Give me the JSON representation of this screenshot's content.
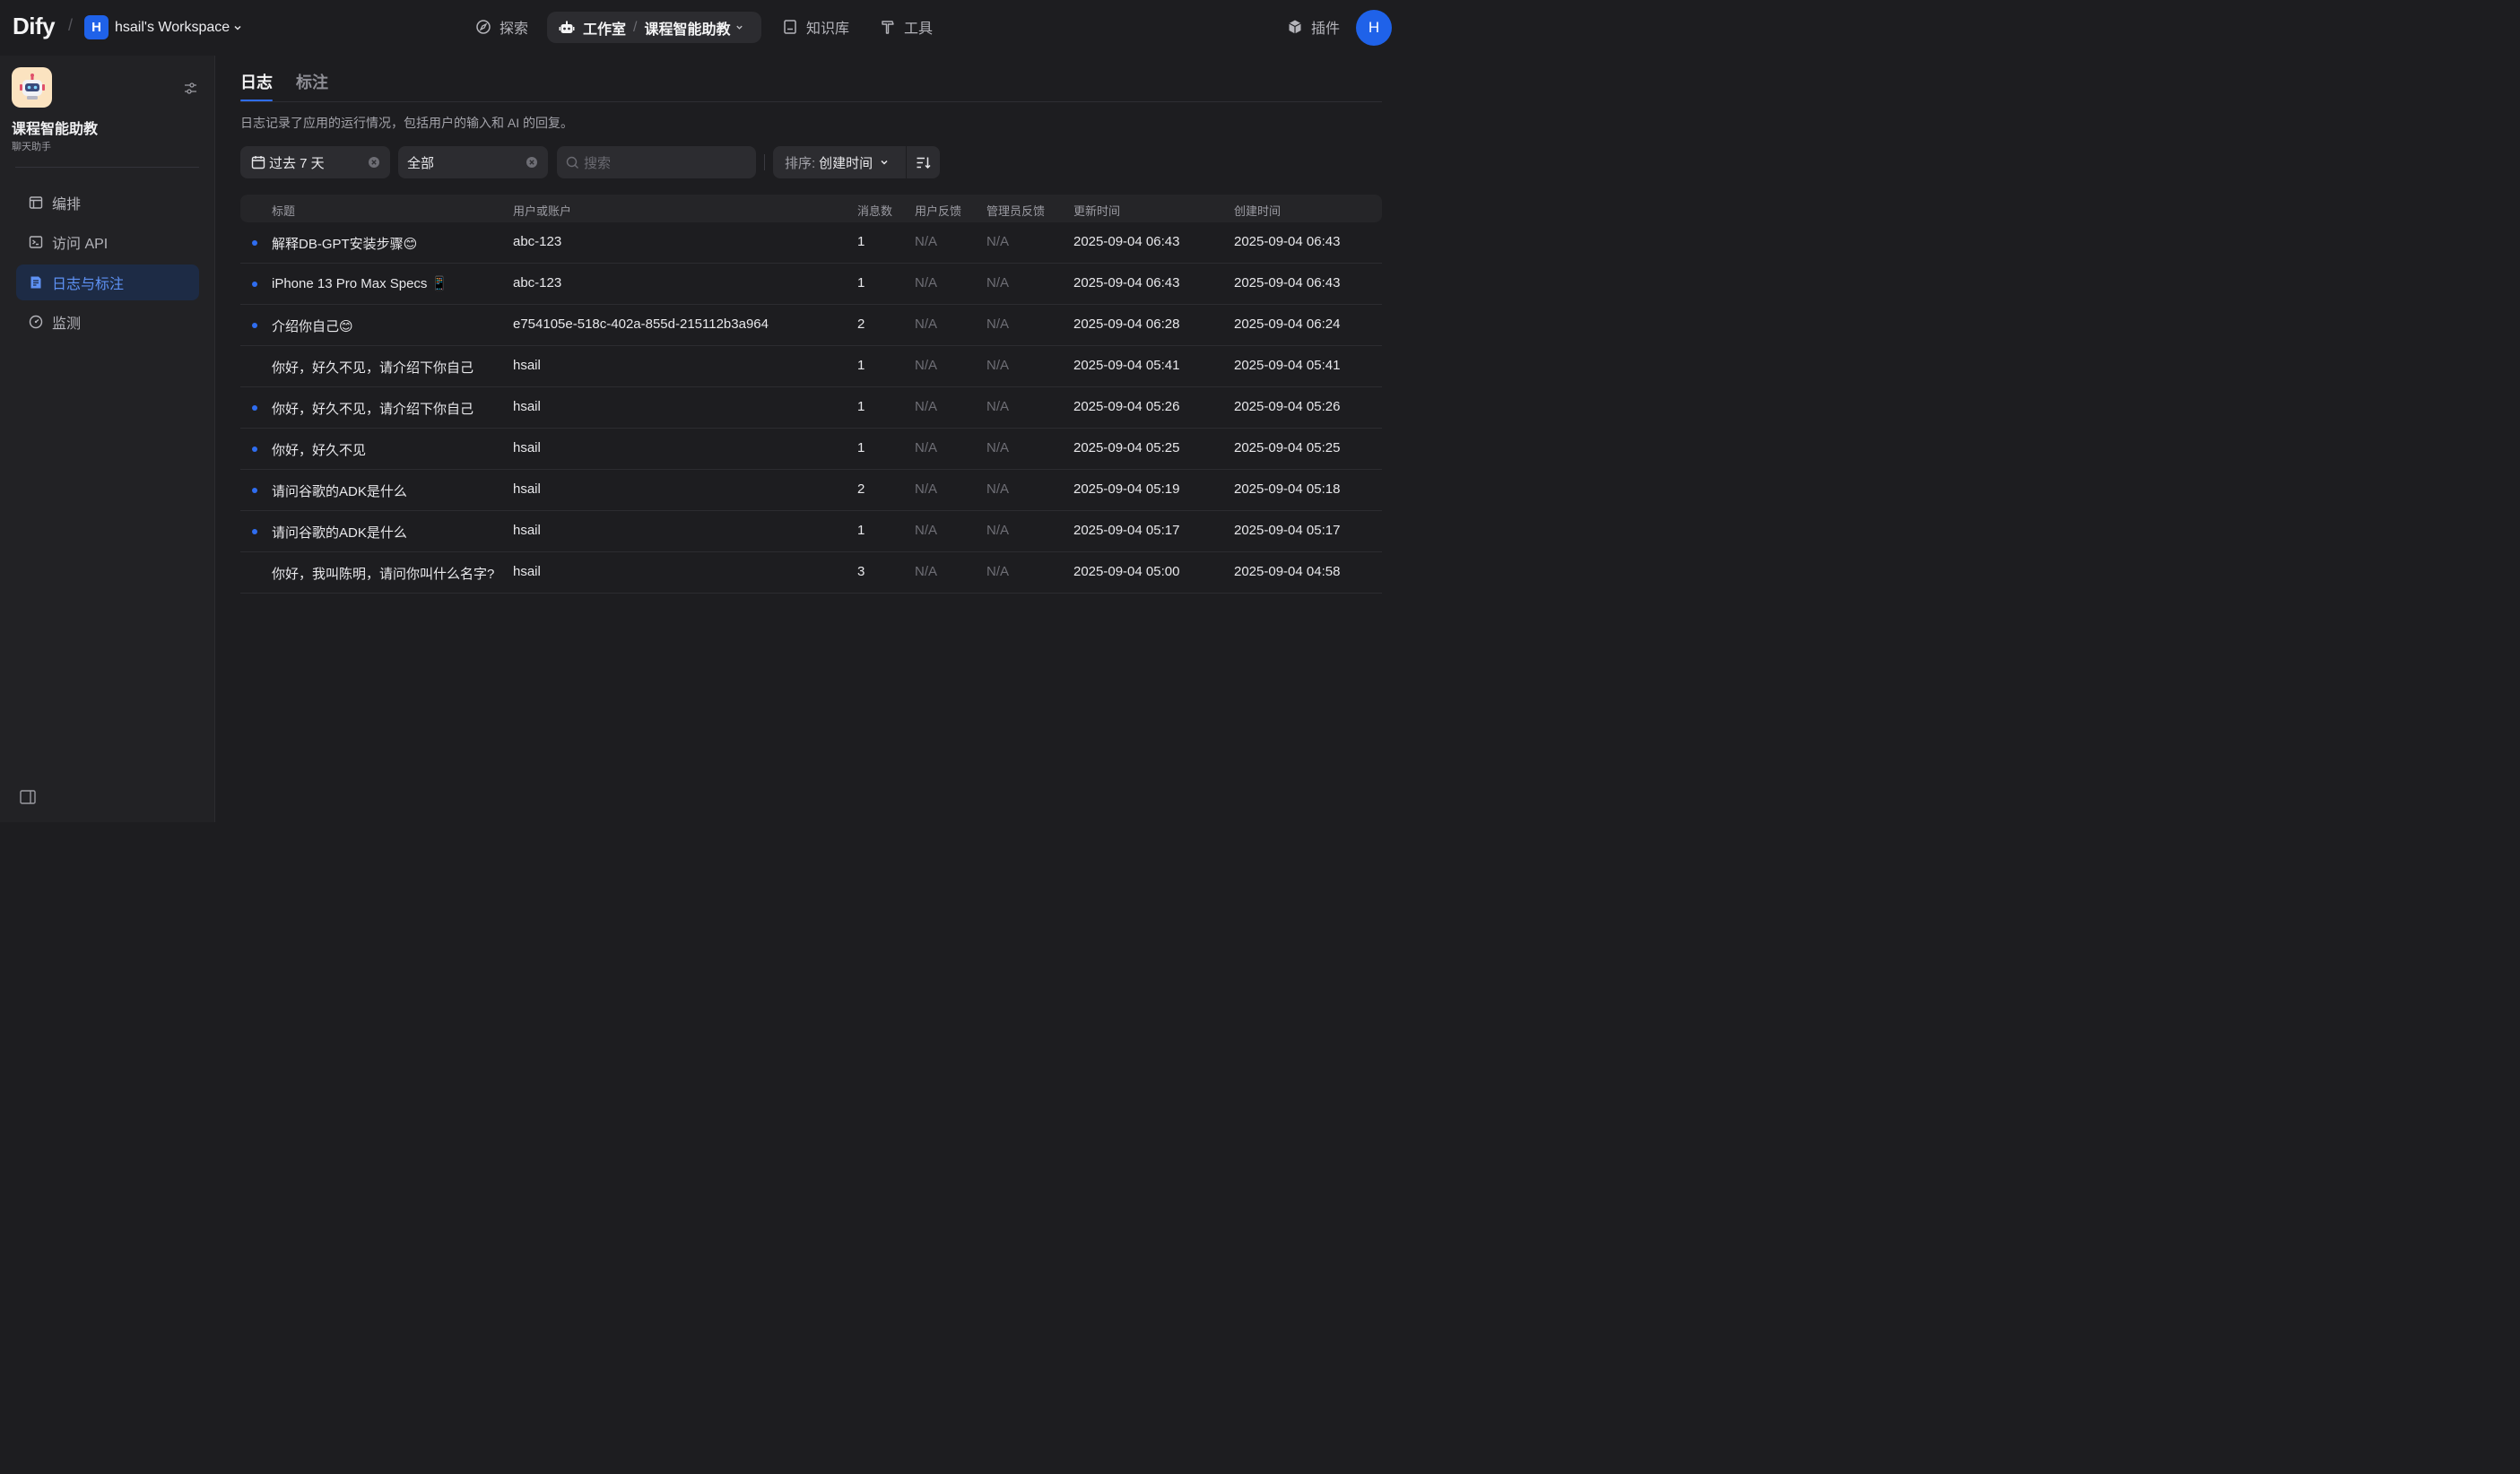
{
  "topbar": {
    "logo": "Dify",
    "workspace_badge": "H",
    "workspace_name": "hsail's Workspace",
    "nav_explore": "探索",
    "nav_studio": "工作室",
    "nav_current_app": "课程智能助教",
    "nav_knowledge": "知识库",
    "nav_tools": "工具",
    "nav_plugins": "插件",
    "user_avatar": "H"
  },
  "sidebar": {
    "app_name": "课程智能助教",
    "app_type": "聊天助手",
    "items": [
      {
        "label": "编排"
      },
      {
        "label": "访问 API"
      },
      {
        "label": "日志与标注"
      },
      {
        "label": "监测"
      }
    ]
  },
  "main": {
    "tabs": [
      {
        "label": "日志"
      },
      {
        "label": "标注"
      }
    ],
    "description": "日志记录了应用的运行情况，包括用户的输入和 AI 的回复。",
    "filters": {
      "date_range": "过去 7 天",
      "annotation_status": "全部",
      "search_placeholder": "搜索",
      "sort_label": "排序:",
      "sort_value": "创建时间"
    },
    "columns": [
      "标题",
      "用户或账户",
      "消息数",
      "用户反馈",
      "管理员反馈",
      "更新时间",
      "创建时间"
    ],
    "rows": [
      {
        "unread": true,
        "title": "解释DB-GPT安装步骤😊",
        "user": "abc-123",
        "messages": "1",
        "user_feedback": "N/A",
        "admin_feedback": "N/A",
        "updated": "2025-09-04 06:43",
        "created": "2025-09-04 06:43"
      },
      {
        "unread": true,
        "title": "iPhone 13 Pro Max Specs 📱",
        "user": "abc-123",
        "messages": "1",
        "user_feedback": "N/A",
        "admin_feedback": "N/A",
        "updated": "2025-09-04 06:43",
        "created": "2025-09-04 06:43"
      },
      {
        "unread": true,
        "title": "介绍你自己😊",
        "user": "e754105e-518c-402a-855d-215112b3a964",
        "messages": "2",
        "user_feedback": "N/A",
        "admin_feedback": "N/A",
        "updated": "2025-09-04 06:28",
        "created": "2025-09-04 06:24"
      },
      {
        "unread": false,
        "title": "你好，好久不见，请介绍下你自己",
        "user": "hsail",
        "messages": "1",
        "user_feedback": "N/A",
        "admin_feedback": "N/A",
        "updated": "2025-09-04 05:41",
        "created": "2025-09-04 05:41"
      },
      {
        "unread": true,
        "title": "你好，好久不见，请介绍下你自己",
        "user": "hsail",
        "messages": "1",
        "user_feedback": "N/A",
        "admin_feedback": "N/A",
        "updated": "2025-09-04 05:26",
        "created": "2025-09-04 05:26"
      },
      {
        "unread": true,
        "title": "你好，好久不见",
        "user": "hsail",
        "messages": "1",
        "user_feedback": "N/A",
        "admin_feedback": "N/A",
        "updated": "2025-09-04 05:25",
        "created": "2025-09-04 05:25"
      },
      {
        "unread": true,
        "title": "请问谷歌的ADK是什么",
        "user": "hsail",
        "messages": "2",
        "user_feedback": "N/A",
        "admin_feedback": "N/A",
        "updated": "2025-09-04 05:19",
        "created": "2025-09-04 05:18"
      },
      {
        "unread": true,
        "title": "请问谷歌的ADK是什么",
        "user": "hsail",
        "messages": "1",
        "user_feedback": "N/A",
        "admin_feedback": "N/A",
        "updated": "2025-09-04 05:17",
        "created": "2025-09-04 05:17"
      },
      {
        "unread": false,
        "title": "你好，我叫陈明，请问你叫什么名字?",
        "user": "hsail",
        "messages": "3",
        "user_feedback": "N/A",
        "admin_feedback": "N/A",
        "updated": "2025-09-04 05:00",
        "created": "2025-09-04 04:58"
      }
    ]
  },
  "colors": {
    "background": "#1d1d20",
    "sidebar_bg": "#222225",
    "accent": "#2f6df0",
    "active_item_bg": "#1d2b45",
    "active_item_text": "#5e92f5"
  }
}
